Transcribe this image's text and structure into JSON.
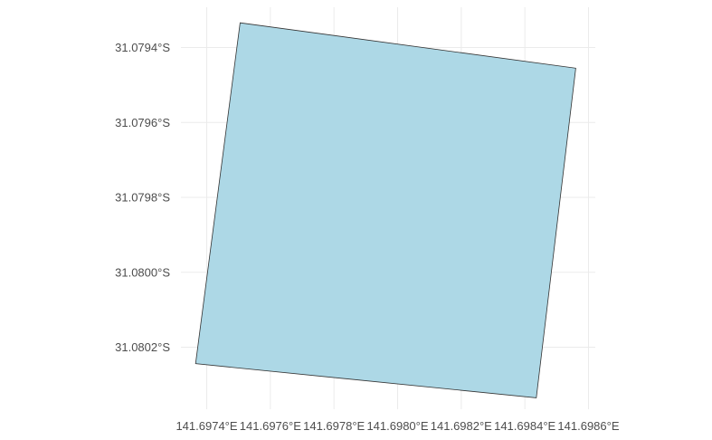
{
  "chart_data": {
    "type": "map",
    "title": "",
    "xlabel": "",
    "ylabel": "",
    "grid": true,
    "legend": "none",
    "fill_color": "#add8e6",
    "outline_color": "#333333",
    "background": "#ffffff",
    "grid_color": "#ebebeb",
    "xlim": [
      141.69733,
      141.69862
    ],
    "ylim": [
      -31.08039,
      -31.07932
    ],
    "x_ticks": [
      {
        "value": 141.6974,
        "label": "141.6974°E"
      },
      {
        "value": 141.6976,
        "label": "141.6976°E"
      },
      {
        "value": 141.6978,
        "label": "141.6978°E"
      },
      {
        "value": 141.698,
        "label": "141.6980°E"
      },
      {
        "value": 141.6982,
        "label": "141.6982°E"
      },
      {
        "value": 141.6984,
        "label": "141.6984°E"
      },
      {
        "value": 141.6986,
        "label": "141.6986°E"
      }
    ],
    "y_ticks": [
      {
        "value": -31.0794,
        "label": "31.0794°S"
      },
      {
        "value": -31.0796,
        "label": "31.0796°S"
      },
      {
        "value": -31.0798,
        "label": "31.0798°S"
      },
      {
        "value": -31.08,
        "label": "31.0800°S"
      },
      {
        "value": -31.0802,
        "label": "31.0802°S"
      }
    ],
    "polygon": [
      {
        "lon": 141.697505,
        "lat": -31.079334
      },
      {
        "lon": 141.69856,
        "lat": -31.079455
      },
      {
        "lon": 141.698436,
        "lat": -31.080335
      },
      {
        "lon": 141.697365,
        "lat": -31.080244
      }
    ]
  }
}
